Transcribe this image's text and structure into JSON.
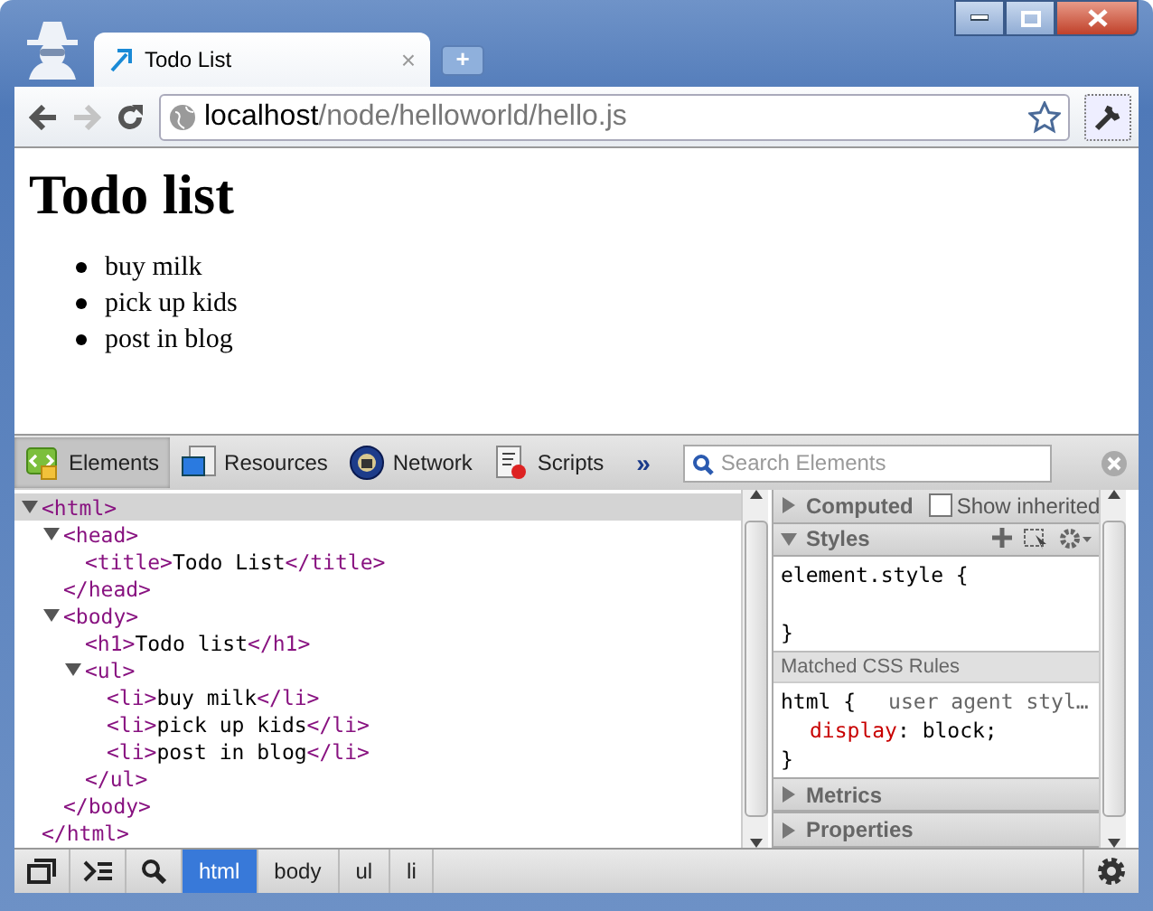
{
  "window": {
    "tab": {
      "title": "Todo List",
      "close": "×"
    },
    "new_tab": "+"
  },
  "toolbar": {
    "back": {
      "disabled": false
    },
    "forward": {
      "disabled": true
    },
    "address": {
      "host": "localhost",
      "path": "/node/helloworld/hello.js"
    }
  },
  "page": {
    "heading": "Todo list",
    "items": [
      "buy milk",
      "pick up kids",
      "post in blog"
    ]
  },
  "devtools": {
    "tabs": [
      {
        "label": "Elements",
        "selected": true
      },
      {
        "label": "Resources",
        "selected": false
      },
      {
        "label": "Network",
        "selected": false
      },
      {
        "label": "Scripts",
        "selected": false
      }
    ],
    "overflow": "»",
    "search": {
      "placeholder": "Search Elements"
    },
    "dom_tree": [
      {
        "open": "<html>",
        "expanded": true,
        "selected": true,
        "close": "</html>",
        "children": [
          {
            "open": "<head>",
            "expanded": true,
            "selected": false,
            "close": "</head>",
            "children": [
              {
                "open": "<title>",
                "text": "Todo List",
                "close": "</title>",
                "selected": false
              }
            ]
          },
          {
            "open": "<body>",
            "expanded": true,
            "selected": false,
            "close": "</body>",
            "children": [
              {
                "open": "<h1>",
                "text": "Todo list",
                "close": "</h1>",
                "selected": false
              },
              {
                "open": "<ul>",
                "expanded": true,
                "selected": false,
                "close": "</ul>",
                "children": [
                  {
                    "open": "<li>",
                    "text": "buy milk",
                    "close": "</li>",
                    "selected": false
                  },
                  {
                    "open": "<li>",
                    "text": "pick up kids",
                    "close": "</li>",
                    "selected": false
                  },
                  {
                    "open": "<li>",
                    "text": "post in blog",
                    "close": "</li>",
                    "selected": false
                  }
                ]
              }
            ]
          }
        ]
      }
    ],
    "sidebar": {
      "computed": {
        "title": "Computed",
        "expanded": false,
        "checkbox_label": "Show inherited",
        "checked": false
      },
      "styles": {
        "title": "Styles",
        "expanded": true,
        "element_style": {
          "open": "element.style {",
          "close": "}"
        },
        "matched_header": "Matched CSS Rules",
        "rule": {
          "selector": "html {",
          "origin": "user agent styl…",
          "property": "display",
          "value": ": block;",
          "close": "}"
        }
      },
      "panes": [
        {
          "title": "Metrics",
          "expanded": false
        },
        {
          "title": "Properties",
          "expanded": false
        }
      ]
    },
    "breadcrumbs": [
      {
        "label": "html",
        "selected": true
      },
      {
        "label": "body",
        "selected": false
      },
      {
        "label": "ul",
        "selected": false
      },
      {
        "label": "li",
        "selected": false
      }
    ]
  }
}
